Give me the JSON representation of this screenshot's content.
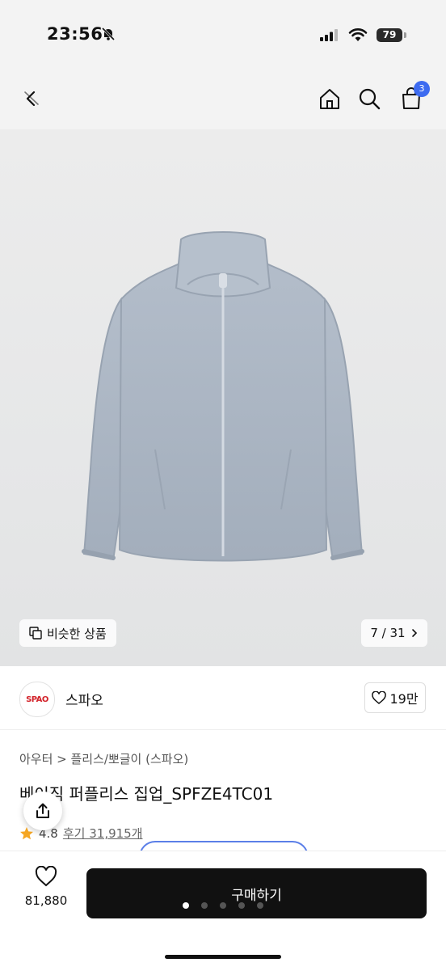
{
  "status": {
    "time": "23:56",
    "battery": "79"
  },
  "nav": {
    "cart_count": "3"
  },
  "gallery": {
    "similar_label": "비슷한 상품",
    "page_counter": "7 / 31"
  },
  "brand": {
    "logo_text": "SPAO",
    "name": "스파오",
    "likes": "19만"
  },
  "product": {
    "breadcrumb": "아우터 > 플리스/뽀글이 (스파오)",
    "title": "베이직 퍼플리스 집업_SPFZE4TC01",
    "rating": "4.8",
    "reviews": "후기 31,915개"
  },
  "bottom": {
    "wish_count": "81,880",
    "buy_label": "구매하기"
  },
  "colors": {
    "accent": "#3d6bf0",
    "buy_button": "#111111",
    "jacket": "#aab5c3"
  }
}
